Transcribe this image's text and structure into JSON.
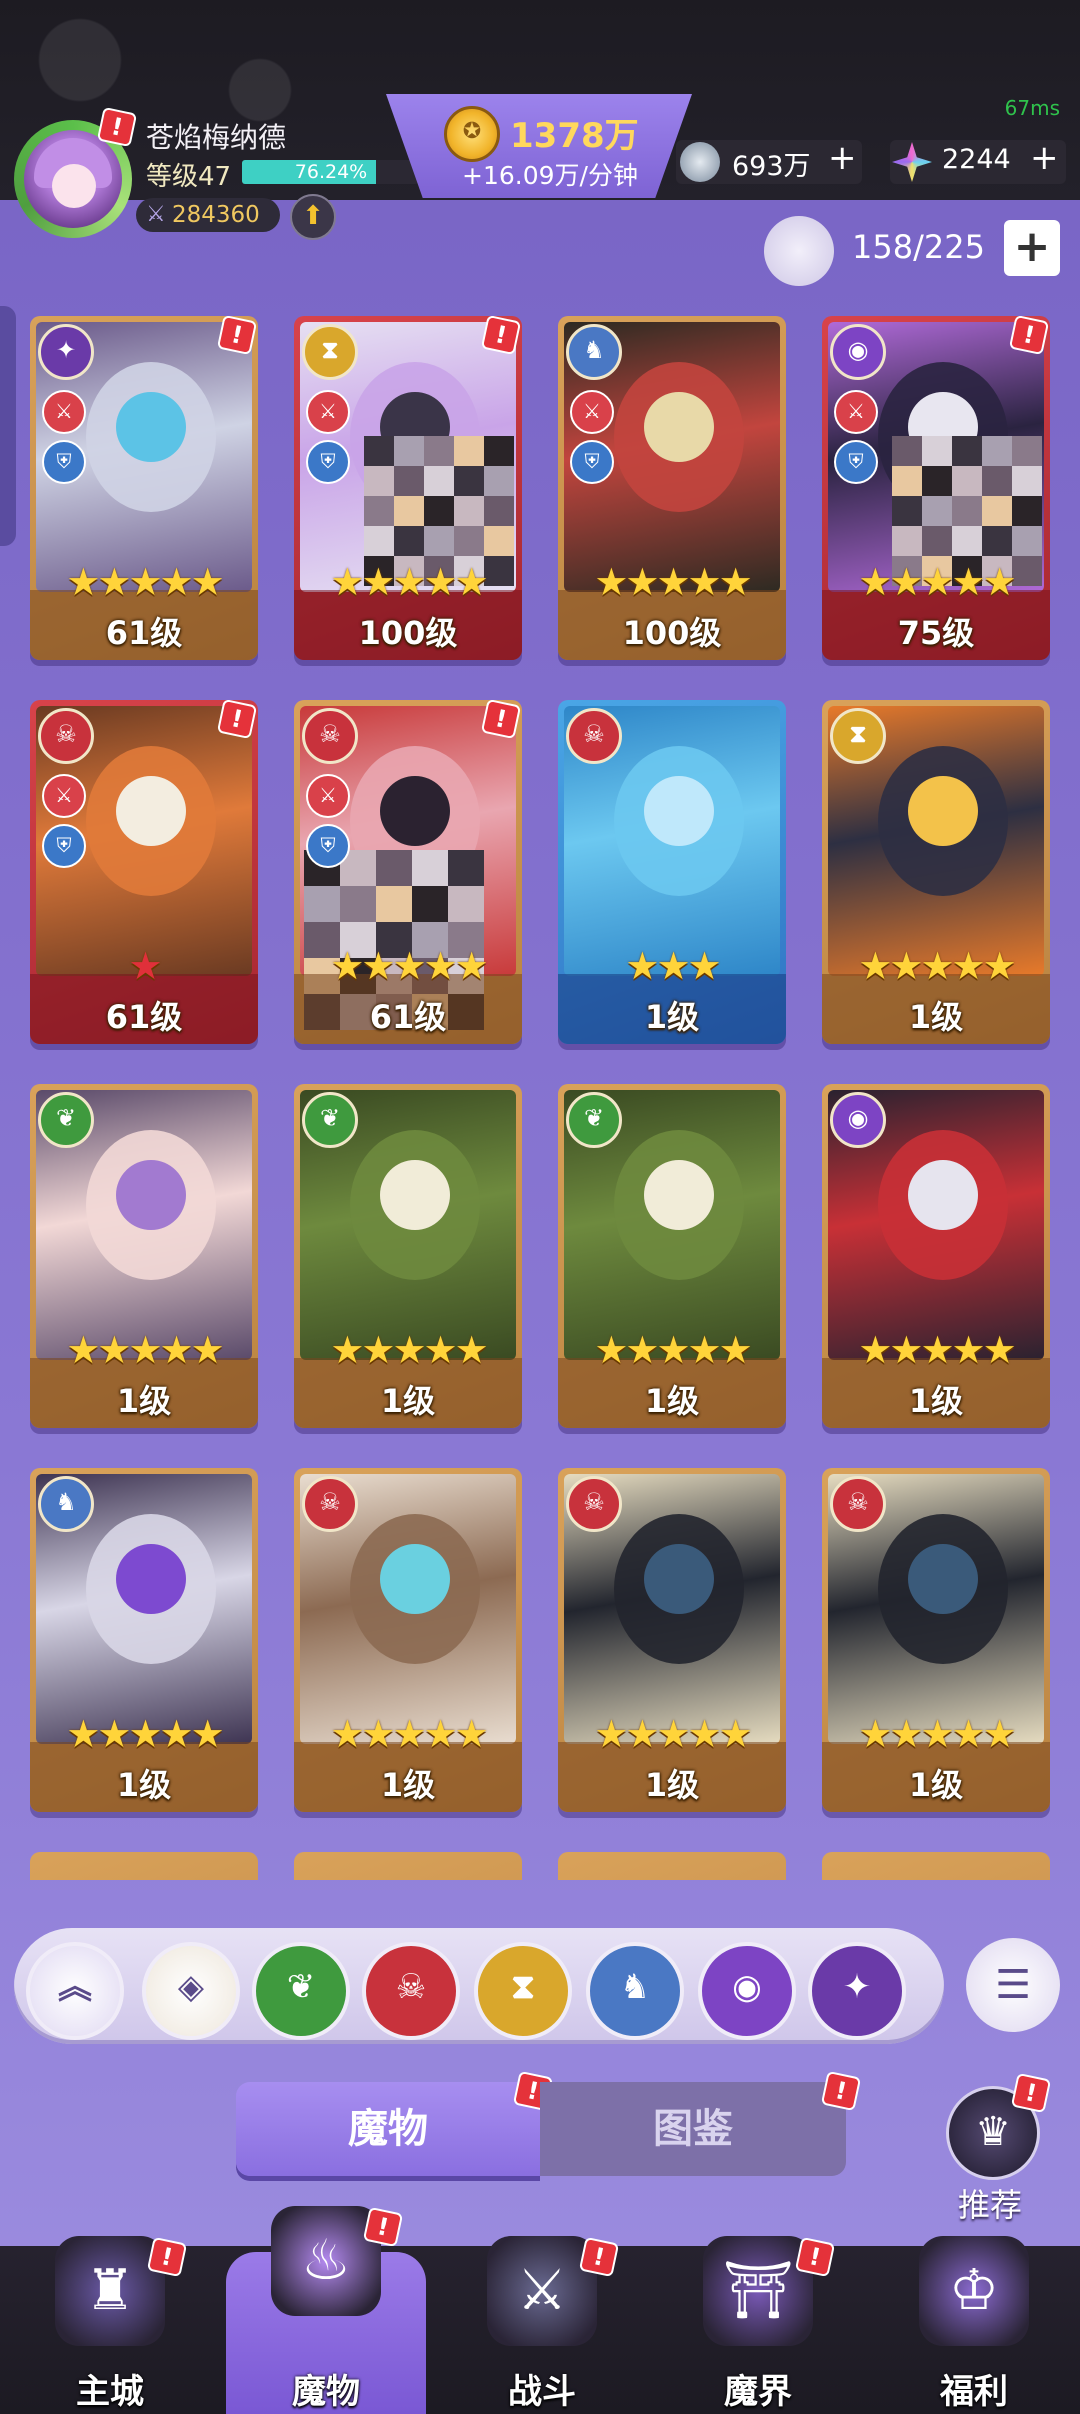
{
  "status": {
    "latency": "67ms"
  },
  "player": {
    "name": "苍焰梅纳德",
    "level_label": "等级47",
    "exp_percent_label": "76.24%",
    "exp_fraction": 0.7624,
    "power": "284360"
  },
  "currency": {
    "gold": "1378万",
    "gold_rate": "+16.09万/分钟",
    "silver": "693万",
    "gem": "2244",
    "add_symbol": "+"
  },
  "roster": {
    "count": "158/225",
    "add_symbol": "+"
  },
  "cards": [
    {
      "level": "61级",
      "stars": "★★★★★",
      "frame": "gold",
      "element": "mystic",
      "badge": true
    },
    {
      "level": "100级",
      "stars": "★★★★★",
      "frame": "red",
      "element": "time",
      "badge": true
    },
    {
      "level": "100级",
      "stars": "★★★★★",
      "frame": "gold",
      "element": "beast",
      "badge": false
    },
    {
      "level": "75级",
      "stars": "★★★★★",
      "frame": "red",
      "element": "eye",
      "badge": true
    },
    {
      "level": "61级",
      "stars": "★",
      "frame": "red",
      "element": "demon",
      "badge": true
    },
    {
      "level": "61级",
      "stars": "★★★★★",
      "frame": "gold",
      "element": "demon",
      "badge": true
    },
    {
      "level": "1级",
      "stars": "★★★",
      "frame": "blue",
      "element": "demon",
      "badge": false
    },
    {
      "level": "1级",
      "stars": "★★★★★",
      "frame": "gold",
      "element": "time",
      "badge": false
    },
    {
      "level": "1级",
      "stars": "★★★★★",
      "frame": "gold",
      "element": "nature",
      "badge": false
    },
    {
      "level": "1级",
      "stars": "★★★★★",
      "frame": "gold",
      "element": "nature",
      "badge": false
    },
    {
      "level": "1级",
      "stars": "★★★★★",
      "frame": "gold",
      "element": "nature",
      "badge": false
    },
    {
      "level": "1级",
      "stars": "★★★★★",
      "frame": "gold",
      "element": "eye",
      "badge": false
    },
    {
      "level": "1级",
      "stars": "★★★★★",
      "frame": "gold",
      "element": "beast",
      "badge": false
    },
    {
      "level": "1级",
      "stars": "★★★★★",
      "frame": "gold",
      "element": "demon",
      "badge": false
    },
    {
      "level": "1级",
      "stars": "★★★★★",
      "frame": "gold",
      "element": "demon",
      "badge": false
    },
    {
      "level": "1级",
      "stars": "★★★★★",
      "frame": "gold",
      "element": "demon",
      "badge": false
    }
  ],
  "filters": [
    {
      "icon": "collapse-up-icon",
      "symbol": "︽"
    },
    {
      "icon": "all-elements-icon",
      "symbol": "◈"
    },
    {
      "icon": "nature-element-icon",
      "symbol": "❦"
    },
    {
      "icon": "demon-element-icon",
      "symbol": "☠"
    },
    {
      "icon": "time-element-icon",
      "symbol": "⧗"
    },
    {
      "icon": "beast-element-icon",
      "symbol": "♞"
    },
    {
      "icon": "eye-element-icon",
      "symbol": "◉"
    },
    {
      "icon": "mystic-element-icon",
      "symbol": "✦"
    }
  ],
  "tabs": {
    "monster": "魔物",
    "codex": "图鉴"
  },
  "recommend": {
    "label": "推荐"
  },
  "nav": [
    {
      "label": "主城",
      "icon": "castle-icon"
    },
    {
      "label": "魔物",
      "icon": "monster-flame-icon"
    },
    {
      "label": "战斗",
      "icon": "battle-sword-icon"
    },
    {
      "label": "魔界",
      "icon": "demon-realm-portal-icon"
    },
    {
      "label": "福利",
      "icon": "treasure-chest-icon"
    }
  ],
  "colors": {
    "background": "#7b68c8",
    "gold_text": "#ffd85c",
    "exp_bar": "#3ed0c4",
    "badge_red": "#e5323a",
    "nature": "#3f9a3e",
    "demon": "#c8323c",
    "time": "#d9a72c",
    "beast": "#4a78c4",
    "eye": "#7d44c4",
    "mystic": "#6a3aa8"
  }
}
